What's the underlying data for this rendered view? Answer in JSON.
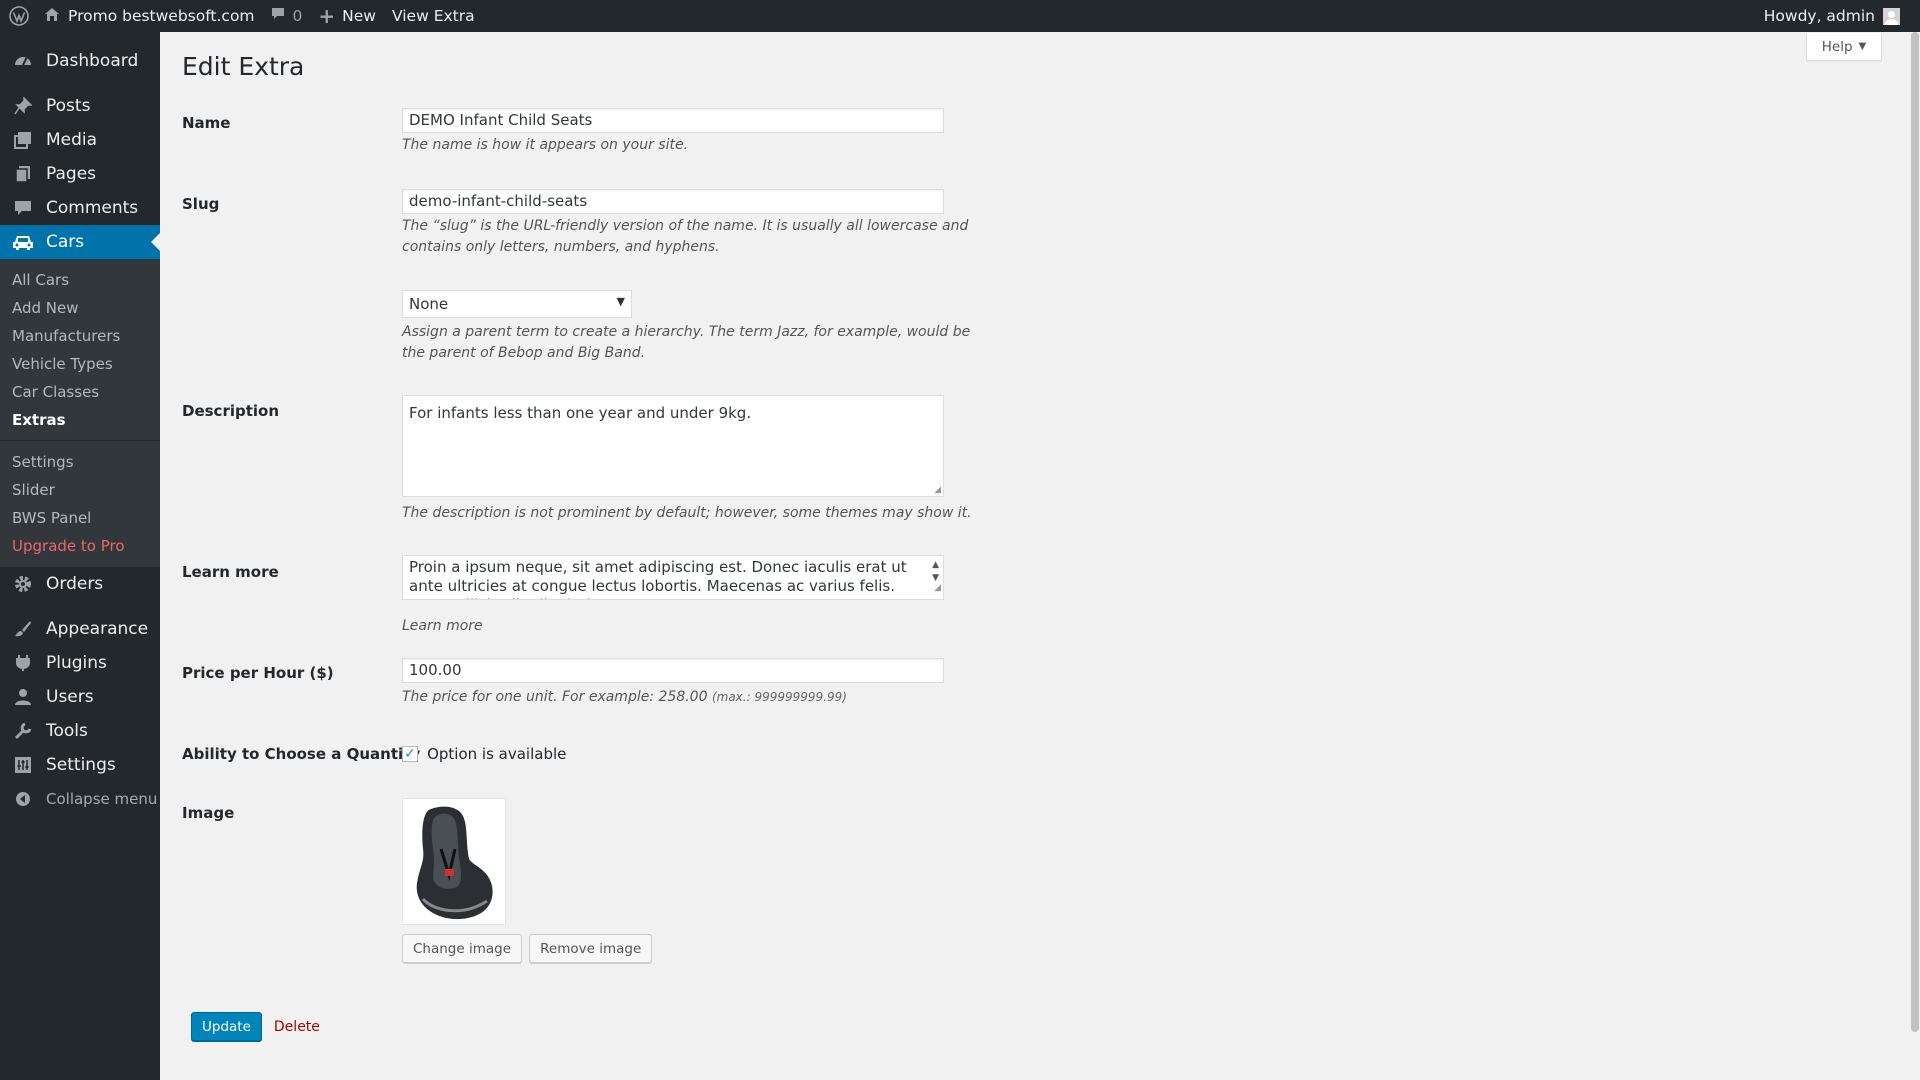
{
  "adminbar": {
    "site_name": "Promo bestwebsoft.com",
    "comments_count": "0",
    "new_label": "New",
    "view_label": "View Extra",
    "greeting": "Howdy, admin"
  },
  "sidebar": {
    "items_top": [
      {
        "label": "Dashboard",
        "icon": "dashboard-icon"
      },
      {
        "label": "Posts",
        "icon": "pin-icon"
      },
      {
        "label": "Media",
        "icon": "media-icon"
      },
      {
        "label": "Pages",
        "icon": "pages-icon"
      },
      {
        "label": "Comments",
        "icon": "comment-icon"
      }
    ],
    "active": {
      "label": "Cars",
      "icon": "car-icon"
    },
    "submenu": [
      "All Cars",
      "Add New",
      "Manufacturers",
      "Vehicle Types",
      "Car Classes",
      "Extras",
      "Settings",
      "Slider",
      "BWS Panel",
      "Upgrade to Pro"
    ],
    "items_bottom": [
      {
        "label": "Orders",
        "icon": "gear-icon"
      },
      {
        "label": "Appearance",
        "icon": "brush-icon"
      },
      {
        "label": "Plugins",
        "icon": "plugin-icon"
      },
      {
        "label": "Users",
        "icon": "user-icon"
      },
      {
        "label": "Tools",
        "icon": "wrench-icon"
      },
      {
        "label": "Settings",
        "icon": "settings-icon"
      }
    ],
    "collapse": "Collapse menu"
  },
  "help_label": "Help",
  "page_title": "Edit Extra",
  "form": {
    "name": {
      "label": "Name",
      "value": "DEMO Infant Child Seats",
      "desc": "The name is how it appears on your site."
    },
    "slug": {
      "label": "Slug",
      "value": "demo-infant-child-seats",
      "desc": "The “slug” is the URL-friendly version of the name. It is usually all lowercase and contains only letters, numbers, and hyphens."
    },
    "parent": {
      "value": "None",
      "desc": "Assign a parent term to create a hierarchy. The term Jazz, for example, would be the parent of Bebop and Big Band."
    },
    "description": {
      "label": "Description",
      "value": "For infants less than one year and under 9kg.",
      "desc": "The description is not prominent by default; however, some themes may show it."
    },
    "learn_more": {
      "label": "Learn more",
      "value": "Proin a ipsum neque, sit amet adipiscing est. Donec iaculis erat ut ante ultricies at congue lectus lobortis. Maecenas ac varius felis. Nam sollicitudin dignissim",
      "desc": "Learn more"
    },
    "price": {
      "label": "Price per Hour ($)",
      "value": "100.00",
      "desc": "The price for one unit. For example: 258.00",
      "desc_small": "(max.: 999999999.99)"
    },
    "quantity": {
      "label": "Ability to Choose a Quantity",
      "checkbox_label": "Option is available",
      "checked": true
    },
    "image": {
      "label": "Image",
      "change_label": "Change image",
      "remove_label": "Remove image"
    }
  },
  "actions": {
    "update_label": "Update",
    "delete_label": "Delete"
  }
}
